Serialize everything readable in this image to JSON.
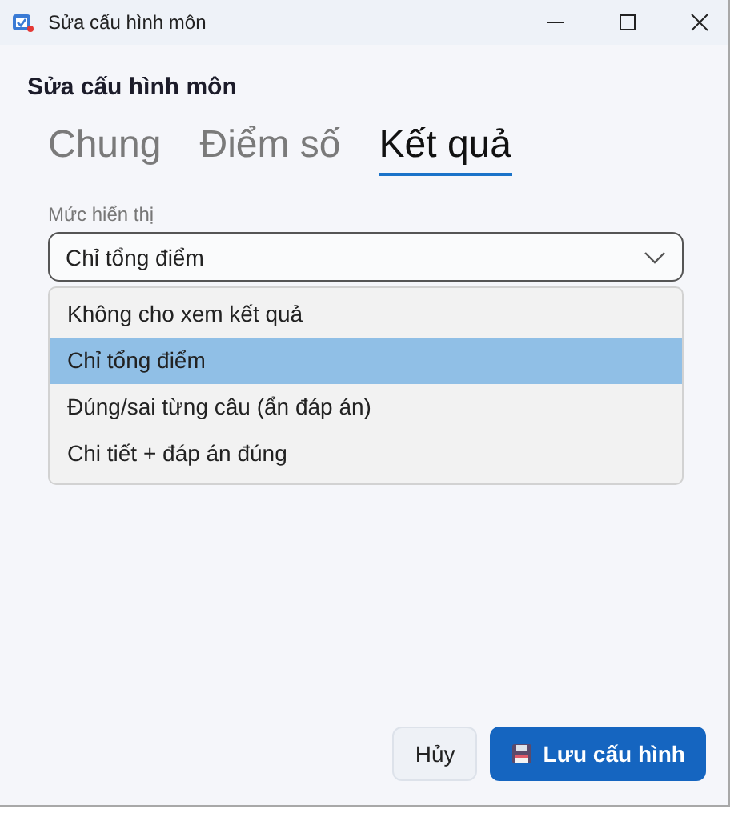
{
  "window": {
    "title": "Sửa cấu hình môn"
  },
  "heading": "Sửa cấu hình môn",
  "tabs": [
    {
      "label": "Chung",
      "selected": false
    },
    {
      "label": "Điểm số",
      "selected": false
    },
    {
      "label": "Kết quả",
      "selected": true
    }
  ],
  "field": {
    "label": "Mức hiển thị",
    "value": "Chỉ tổng điểm",
    "expanded": true
  },
  "options": [
    {
      "label": "Không cho xem kết quả",
      "selected": false
    },
    {
      "label": "Chỉ tổng điểm",
      "selected": true
    },
    {
      "label": "Đúng/sai từng câu (ẩn đáp án)",
      "selected": false
    },
    {
      "label": "Chi tiết + đáp án đúng",
      "selected": false
    }
  ],
  "buttons": [
    {
      "label": "Hủy",
      "kind": "secondary"
    },
    {
      "label": "Lưu cấu hình",
      "kind": "primary"
    }
  ]
}
